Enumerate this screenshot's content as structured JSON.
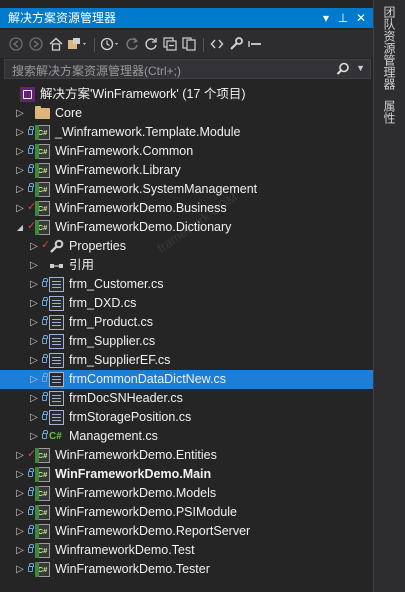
{
  "window": {
    "title": "解决方案资源管理器",
    "dropdown_glyph": "▾",
    "pin_glyph": "⊥",
    "close_glyph": "✕"
  },
  "search": {
    "placeholder": "搜索解决方案资源管理器(Ctrl+;)"
  },
  "tree": [
    {
      "label": "解决方案'WinFramework' (17 个项目)",
      "icon": "solution-icon",
      "arrow": "expanded",
      "level": 0,
      "check": false,
      "lock": false,
      "bold": false,
      "selected": false
    },
    {
      "label": "Core",
      "icon": "folder-icon",
      "arrow": "collapsed",
      "level": 1,
      "check": false,
      "lock": false,
      "bold": false,
      "selected": false
    },
    {
      "label": "_Winframework.Template.Module",
      "icon": "csproj-icon",
      "arrow": "collapsed",
      "level": 1,
      "check": false,
      "lock": true,
      "bold": false,
      "selected": false
    },
    {
      "label": "WinFramework.Common",
      "icon": "csproj-icon",
      "arrow": "collapsed",
      "level": 1,
      "check": false,
      "lock": true,
      "bold": false,
      "selected": false
    },
    {
      "label": "WinFramework.Library",
      "icon": "csproj-icon",
      "arrow": "collapsed",
      "level": 1,
      "check": false,
      "lock": true,
      "bold": false,
      "selected": false
    },
    {
      "label": "WinFramework.SystemManagement",
      "icon": "csproj-icon",
      "arrow": "collapsed",
      "level": 1,
      "check": false,
      "lock": true,
      "bold": false,
      "selected": false
    },
    {
      "label": "WinFrameworkDemo.Business",
      "icon": "csproj-icon",
      "arrow": "collapsed",
      "level": 1,
      "check": true,
      "lock": false,
      "bold": false,
      "selected": false
    },
    {
      "label": "WinFrameworkDemo.Dictionary",
      "icon": "csproj-icon",
      "arrow": "expanded",
      "level": 1,
      "check": true,
      "lock": false,
      "bold": false,
      "selected": false
    },
    {
      "label": "Properties",
      "icon": "wrench-icon",
      "arrow": "collapsed",
      "level": 2,
      "check": true,
      "lock": false,
      "bold": false,
      "selected": false
    },
    {
      "label": "引用",
      "icon": "references-icon",
      "arrow": "collapsed",
      "level": 2,
      "check": false,
      "lock": false,
      "bold": false,
      "selected": false
    },
    {
      "label": "frm_Customer.cs",
      "icon": "form-file-icon",
      "arrow": "collapsed",
      "level": 2,
      "check": false,
      "lock": true,
      "bold": false,
      "selected": false
    },
    {
      "label": "frm_DXD.cs",
      "icon": "form-file-icon",
      "arrow": "collapsed",
      "level": 2,
      "check": false,
      "lock": true,
      "bold": false,
      "selected": false
    },
    {
      "label": "frm_Product.cs",
      "icon": "form-file-icon",
      "arrow": "collapsed",
      "level": 2,
      "check": false,
      "lock": true,
      "bold": false,
      "selected": false
    },
    {
      "label": "frm_Supplier.cs",
      "icon": "form-file-icon",
      "arrow": "collapsed",
      "level": 2,
      "check": false,
      "lock": true,
      "bold": false,
      "selected": false
    },
    {
      "label": "frm_SupplierEF.cs",
      "icon": "form-file-icon",
      "arrow": "collapsed",
      "level": 2,
      "check": false,
      "lock": true,
      "bold": false,
      "selected": false
    },
    {
      "label": "frmCommonDataDictNew.cs",
      "icon": "form-file-icon",
      "arrow": "collapsed",
      "level": 2,
      "check": false,
      "lock": true,
      "bold": false,
      "selected": true
    },
    {
      "label": "frmDocSNHeader.cs",
      "icon": "form-file-icon",
      "arrow": "collapsed",
      "level": 2,
      "check": false,
      "lock": true,
      "bold": false,
      "selected": false
    },
    {
      "label": "frmStoragePosition.cs",
      "icon": "form-file-icon",
      "arrow": "collapsed",
      "level": 2,
      "check": false,
      "lock": true,
      "bold": false,
      "selected": false
    },
    {
      "label": "Management.cs",
      "icon": "csharp-file-icon",
      "arrow": "collapsed",
      "level": 2,
      "check": false,
      "lock": true,
      "bold": false,
      "selected": false
    },
    {
      "label": "WinFrameworkDemo.Entities",
      "icon": "csproj-icon",
      "arrow": "collapsed",
      "level": 1,
      "check": true,
      "lock": false,
      "bold": false,
      "selected": false
    },
    {
      "label": "WinFrameworkDemo.Main",
      "icon": "csproj-icon",
      "arrow": "collapsed",
      "level": 1,
      "check": false,
      "lock": true,
      "bold": true,
      "selected": false
    },
    {
      "label": "WinFrameworkDemo.Models",
      "icon": "csproj-icon",
      "arrow": "collapsed",
      "level": 1,
      "check": false,
      "lock": true,
      "bold": false,
      "selected": false
    },
    {
      "label": "WinFrameworkDemo.PSIModule",
      "icon": "csproj-icon",
      "arrow": "collapsed",
      "level": 1,
      "check": false,
      "lock": true,
      "bold": false,
      "selected": false
    },
    {
      "label": "WinFrameworkDemo.ReportServer",
      "icon": "csproj-icon",
      "arrow": "collapsed",
      "level": 1,
      "check": false,
      "lock": true,
      "bold": false,
      "selected": false
    },
    {
      "label": "WinframeworkDemo.Test",
      "icon": "csproj-icon",
      "arrow": "collapsed",
      "level": 1,
      "check": false,
      "lock": true,
      "bold": false,
      "selected": false
    },
    {
      "label": "WinFrameworkDemo.Tester",
      "icon": "csproj-icon",
      "arrow": "collapsed",
      "level": 1,
      "check": false,
      "lock": true,
      "bold": false,
      "selected": false
    }
  ],
  "side_tabs": {
    "team_explorer": "团队资源管理器",
    "properties": "属性"
  },
  "watermark": "framework.COM",
  "colors": {
    "title_bar": "#007acc",
    "selection": "#1c7ed6",
    "panel_bg": "#252526"
  }
}
